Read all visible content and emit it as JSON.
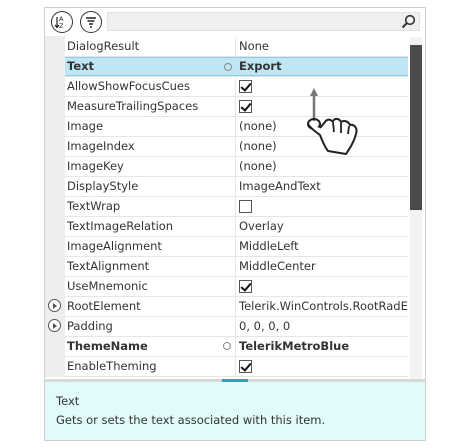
{
  "toolbar": {
    "sort_alpha_icon": "sort-alphabetical-icon",
    "sort_category_icon": "sort-categorized-icon",
    "search_placeholder": "",
    "search_icon": "magnifier-icon"
  },
  "properties": [
    {
      "name": "DialogResult",
      "value": "None",
      "type": "text"
    },
    {
      "name": "Text",
      "value": "Export",
      "type": "text",
      "bold": true,
      "selected": true,
      "modified": true
    },
    {
      "name": "AllowShowFocusCues",
      "value": true,
      "type": "check"
    },
    {
      "name": "MeasureTrailingSpaces",
      "value": true,
      "type": "check"
    },
    {
      "name": "Image",
      "value": "(none)",
      "type": "text"
    },
    {
      "name": "ImageIndex",
      "value": "(none)",
      "type": "text"
    },
    {
      "name": "ImageKey",
      "value": "(none)",
      "type": "text"
    },
    {
      "name": "DisplayStyle",
      "value": "ImageAndText",
      "type": "text"
    },
    {
      "name": "TextWrap",
      "value": false,
      "type": "check"
    },
    {
      "name": "TextImageRelation",
      "value": "Overlay",
      "type": "text"
    },
    {
      "name": "ImageAlignment",
      "value": "MiddleLeft",
      "type": "text"
    },
    {
      "name": "TextAlignment",
      "value": "MiddleCenter",
      "type": "text"
    },
    {
      "name": "UseMnemonic",
      "value": true,
      "type": "check"
    },
    {
      "name": "RootElement",
      "value": "Telerik.WinControls.RootRadEl",
      "type": "text",
      "expandable": true
    },
    {
      "name": "Padding",
      "value": "0, 0, 0, 0",
      "type": "text",
      "expandable": true
    },
    {
      "name": "ThemeName",
      "value": "TelerikMetroBlue",
      "type": "text",
      "bold": true,
      "modified": true
    },
    {
      "name": "EnableTheming",
      "value": true,
      "type": "check"
    }
  ],
  "help": {
    "title": "Text",
    "description": "Gets or sets the text associated with this item."
  },
  "colors": {
    "selection": "#bfe6f5",
    "help_background": "#e1fbfb",
    "splitter_accent": "#25a0da",
    "scroll_thumb": "#4a4a4a"
  },
  "overlay": {
    "gesture_icon": "touch-scroll-hand-icon"
  }
}
